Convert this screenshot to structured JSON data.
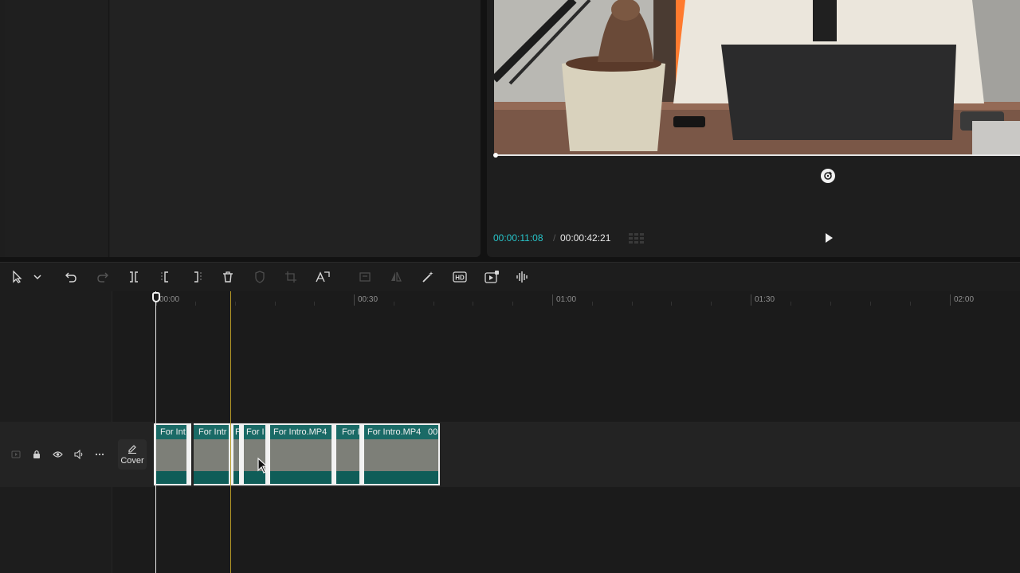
{
  "player": {
    "current_time": "00:00:11:08",
    "separator": "/",
    "total_time": "00:00:42:21",
    "progress": 0.0,
    "accent_color": "#27c3c8"
  },
  "toolbar": {
    "tools": [
      {
        "name": "select-icon",
        "enabled": true
      },
      {
        "name": "chevron-down-icon",
        "enabled": true
      },
      {
        "name": "undo-icon",
        "enabled": true
      },
      {
        "name": "redo-icon",
        "enabled": false
      },
      {
        "name": "split-icon",
        "enabled": true
      },
      {
        "name": "split-left-icon",
        "enabled": true
      },
      {
        "name": "split-right-icon",
        "enabled": true
      },
      {
        "name": "delete-icon",
        "enabled": true
      },
      {
        "name": "shield-icon",
        "enabled": false
      },
      {
        "name": "crop-icon",
        "enabled": false
      },
      {
        "name": "auto-reframe-icon",
        "enabled": true
      },
      {
        "name": "freeze-icon",
        "enabled": false
      },
      {
        "name": "mirror-icon",
        "enabled": false
      },
      {
        "name": "magic-wand-icon",
        "enabled": true
      },
      {
        "name": "hd-icon",
        "enabled": true
      },
      {
        "name": "video-effect-icon",
        "enabled": true
      },
      {
        "name": "audio-wave-icon",
        "enabled": true
      }
    ]
  },
  "timeline": {
    "ruler": [
      "00:00",
      "00:30",
      "01:00",
      "01:30",
      "02:00"
    ],
    "track": {
      "cover_label": "Cover",
      "clips": [
        {
          "name": "For Int"
        },
        {
          "name": "For Intr"
        },
        {
          "name": "F"
        },
        {
          "name": "For I"
        },
        {
          "name": "For Intro.MP4"
        },
        {
          "name": "For I"
        },
        {
          "name": "For Intro.MP4"
        }
      ],
      "last_clip_tail": "00"
    },
    "playhead_color": "#b89a26"
  }
}
